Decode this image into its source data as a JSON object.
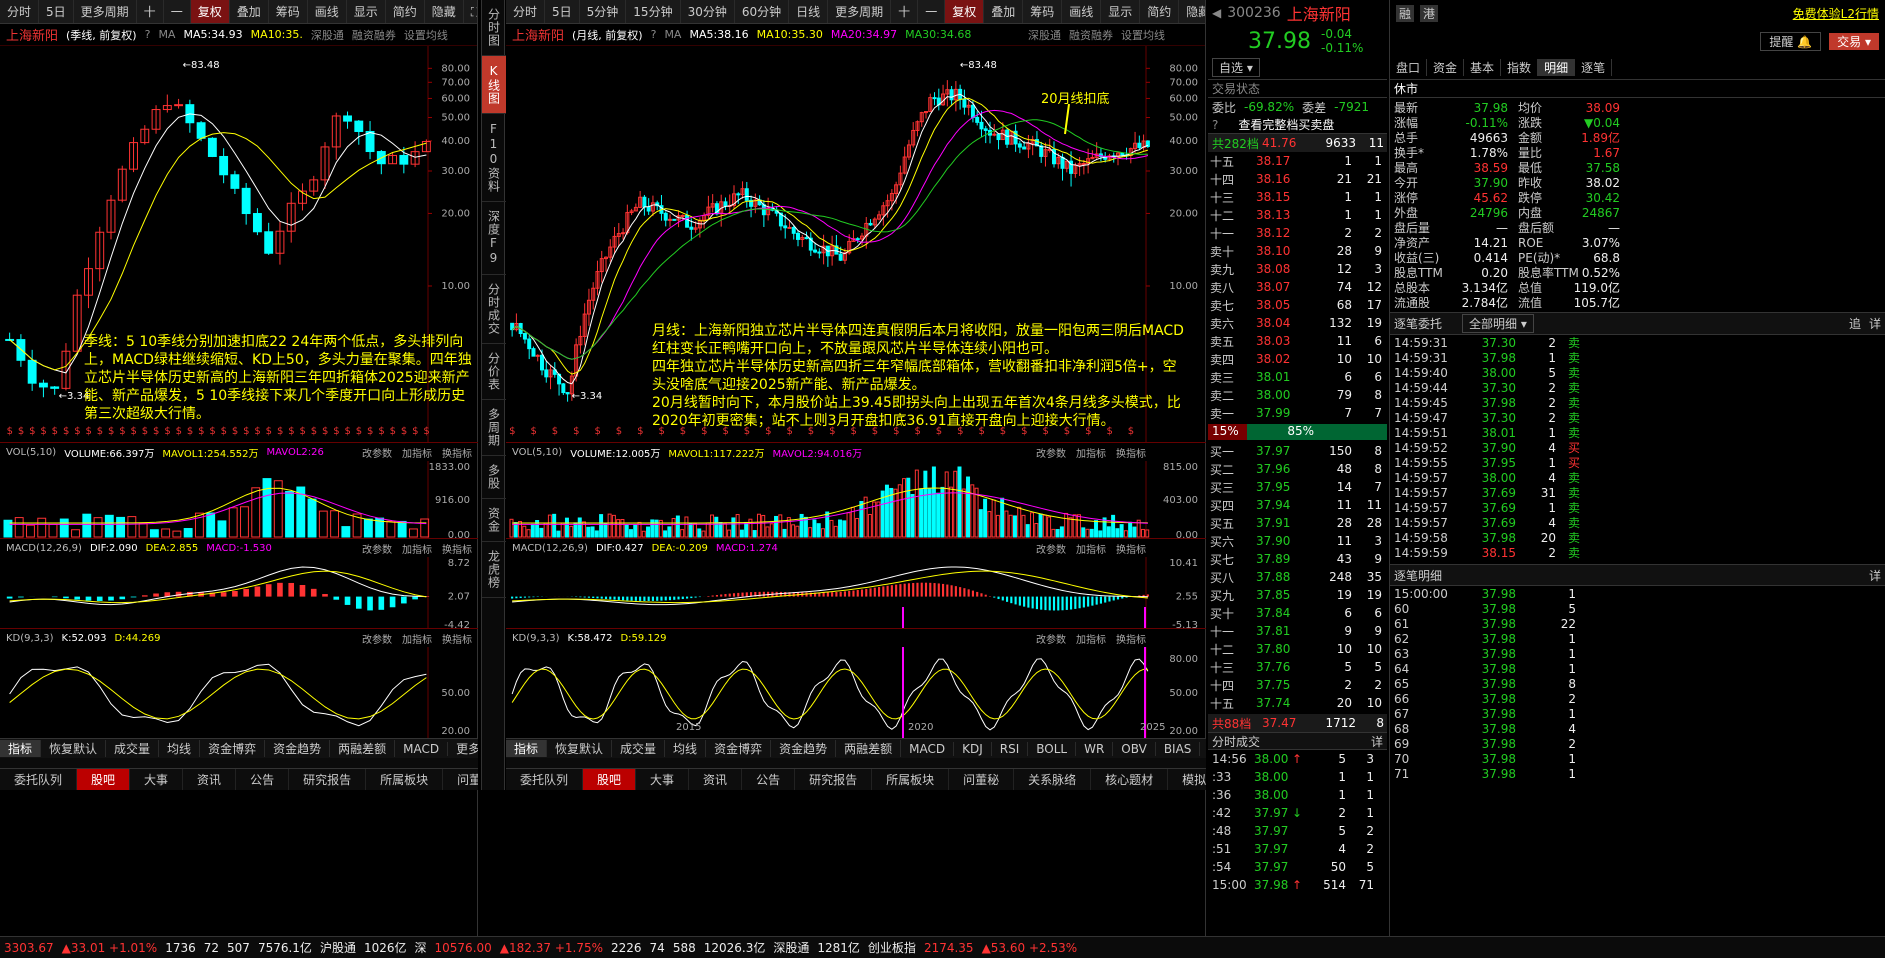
{
  "left": {
    "toolbar": [
      "分时",
      "5日",
      "更多周期",
      "十",
      "一",
      "复权",
      "叠加",
      "筹码",
      "画线",
      "显示",
      "简约",
      "隐藏",
      "⛶"
    ],
    "caption": {
      "name": "上海新阳",
      "period": "(季线, 前复权)",
      "ma_label": "MA",
      "ma5": "MA5:34.93",
      "ma10": "MA10:35.",
      "pill1": "深股通",
      "pill2": "融资融券",
      "setting": "设置均线"
    },
    "price_axis": [
      "80.00",
      "70.00",
      "60.00",
      "50.00",
      "40.00",
      "30.00",
      "20.00",
      "10.00"
    ],
    "hi_label": "83.48",
    "lo_label": "3.34",
    "note": "季线：5 10季线分别加速扣底22 24年两个低点，多头排列向上，MACD绿柱继续缩短、KD上50，多头力量在聚集。四年独立芯片半导体历史新高的上海新阳三年四折箱体2025迎来新产能、新产品爆发，5 10季线接下来几个季度开口向上形成历史第三次超级大行情。",
    "vol": {
      "name": "VOL(5,10)",
      "v": "VOLUME:66.397万",
      "ma1": "MAVOL1:254.552万",
      "ma2": "MAVOL2:26",
      "axis": [
        "1833.00",
        "916.00",
        "0.00"
      ]
    },
    "macd": {
      "name": "MACD(12,26,9)",
      "dif": "DIF:2.090",
      "dea": "DEA:2.855",
      "macd": "MACD:-1.530",
      "axis": [
        "8.72",
        "2.07",
        "-4.42"
      ]
    },
    "kd": {
      "name": "KD(9,3,3)",
      "k": "K:52.093",
      "d": "D:44.269",
      "axis": [
        "50.00",
        "20.00"
      ]
    },
    "ops": [
      "改参数",
      "加指标",
      "换指标"
    ],
    "tabs": [
      "指标",
      "恢复默认",
      "成交量",
      "均线",
      "资金博弈",
      "资金趋势",
      "两融差额",
      "MACD",
      "更多",
      "模板"
    ],
    "bottom_tabs": [
      "委托队列",
      "股吧",
      "大事",
      "资讯",
      "公告",
      "研究报告",
      "所属板块",
      "问董秘",
      "关联"
    ]
  },
  "vtabs": [
    "分时图",
    "K线图",
    "F10资料",
    "深度F9",
    "分时成交",
    "分价表",
    "多周期",
    "多股",
    "资金",
    "龙虎榜"
  ],
  "mid": {
    "toolbar": [
      "分时",
      "5日",
      "5分钟",
      "15分钟",
      "30分钟",
      "60分钟",
      "日线",
      "更多周期",
      "十",
      "一",
      "复权",
      "叠加",
      "筹码",
      "画线",
      "显示",
      "简约",
      "隐藏",
      "⛶"
    ],
    "caption": {
      "name": "上海新阳",
      "period": "(月线, 前复权)",
      "ma_label": "MA",
      "ma5": "MA5:38.16",
      "ma10": "MA10:35.30",
      "ma20": "MA20:34.97",
      "ma30": "MA30:34.68",
      "pill1": "深股通",
      "pill2": "融资融券",
      "setting": "设置均线"
    },
    "price_axis": [
      "80.00",
      "70.00",
      "60.00",
      "50.00",
      "40.00",
      "30.00",
      "20.00",
      "10.00"
    ],
    "hi_label": "83.48",
    "lo_label": "3.34",
    "annot": "20月线扣底",
    "note": "月线：上海新阳独立芯片半导体四连真假阴后本月将收阳，放量一阳包两三阴后MACD红柱变长正鸭嘴开口向上，不放量跟风芯片半导体连续小阳也可。\n四年独立芯片半导体历史新高四折三年窄幅底部箱体，营收翻番扣非净利润5倍+，空头没啥底气迎接2025新产能、新产品爆发。\n20月线暂时向下，本月股价站上39.45即拐头向上出现五年首次4条月线多头模式，比2020年初更密集；站不上则3月开盘扣底36.91直接开盘向上迎接大行情。",
    "vol": {
      "name": "VOL(5,10)",
      "v": "VOLUME:12.005万",
      "ma1": "MAVOL1:117.222万",
      "ma2": "MAVOL2:94.016万",
      "axis": [
        "815.00",
        "403.00",
        "0.00"
      ]
    },
    "macd": {
      "name": "MACD(12,26,9)",
      "dif": "DIF:0.427",
      "dea": "DEA:-0.209",
      "macd": "MACD:1.274",
      "axis": [
        "10.41",
        "2.55",
        "-5.13"
      ]
    },
    "kd": {
      "name": "KD(9,3,3)",
      "k": "K:58.472",
      "d": "D:59.129",
      "axis": [
        "80.00",
        "50.00",
        "20.00"
      ]
    },
    "ops": [
      "改参数",
      "加指标",
      "换指标"
    ],
    "years": [
      "2015",
      "2020",
      "2025"
    ],
    "tabs": [
      "指标",
      "恢复默认",
      "成交量",
      "均线",
      "资金博弈",
      "资金趋势",
      "两融差额",
      "MACD",
      "KDJ",
      "RSI",
      "BOLL",
      "WR",
      "OBV",
      "BIAS",
      "更多",
      "模板"
    ],
    "bottom_tabs": [
      "委托队列",
      "股吧",
      "大事",
      "资讯",
      "公告",
      "研究报告",
      "所属板块",
      "问董秘",
      "关系脉络",
      "核心题材",
      "模拟交易"
    ]
  },
  "quote": {
    "code": "300236",
    "name": "上海新阳",
    "tag1": "融",
    "tag2": "港",
    "promo": "免费体验L2行情",
    "price": "37.98",
    "chg": "-0.04",
    "pct": "-0.11%",
    "btn_self": "自选",
    "btn_alert": "提醒",
    "btn_trade": "交易",
    "status": "交易状态",
    "status_v": "休市",
    "wb_l": "委比",
    "wb_v": "-69.82%",
    "wc_l": "委差",
    "wc_v": "-7921",
    "full_book": "查看完整档买卖盘",
    "sell_total": {
      "label": "共282档",
      "price": "41.76",
      "vol": "9633",
      "n": "11"
    },
    "asks": [
      {
        "l": "十五",
        "p": "38.17",
        "v": "1",
        "n": "1"
      },
      {
        "l": "十四",
        "p": "38.16",
        "v": "21",
        "n": "21"
      },
      {
        "l": "十三",
        "p": "38.15",
        "v": "1",
        "n": "1"
      },
      {
        "l": "十二",
        "p": "38.13",
        "v": "1",
        "n": "1"
      },
      {
        "l": "十一",
        "p": "38.12",
        "v": "2",
        "n": "2"
      },
      {
        "l": "卖十",
        "p": "38.10",
        "v": "28",
        "n": "9"
      },
      {
        "l": "卖九",
        "p": "38.08",
        "v": "12",
        "n": "3"
      },
      {
        "l": "卖八",
        "p": "38.07",
        "v": "74",
        "n": "12"
      },
      {
        "l": "卖七",
        "p": "38.05",
        "v": "68",
        "n": "17"
      },
      {
        "l": "卖六",
        "p": "38.04",
        "v": "132",
        "n": "19"
      },
      {
        "l": "卖五",
        "p": "38.03",
        "v": "11",
        "n": "6"
      },
      {
        "l": "卖四",
        "p": "38.02",
        "v": "10",
        "n": "10"
      },
      {
        "l": "卖三",
        "p": "38.01",
        "v": "6",
        "n": "6"
      },
      {
        "l": "卖二",
        "p": "38.00",
        "v": "79",
        "n": "8"
      },
      {
        "l": "卖一",
        "p": "37.99",
        "v": "7",
        "n": "7"
      }
    ],
    "ratio": {
      "l": "15%",
      "r": "85%"
    },
    "bids": [
      {
        "l": "买一",
        "p": "37.97",
        "v": "150",
        "n": "8"
      },
      {
        "l": "买二",
        "p": "37.96",
        "v": "48",
        "n": "8"
      },
      {
        "l": "买三",
        "p": "37.95",
        "v": "14",
        "n": "7"
      },
      {
        "l": "买四",
        "p": "37.94",
        "v": "11",
        "n": "11"
      },
      {
        "l": "买五",
        "p": "37.91",
        "v": "28",
        "n": "28"
      },
      {
        "l": "买六",
        "p": "37.90",
        "v": "11",
        "n": "3"
      },
      {
        "l": "买七",
        "p": "37.89",
        "v": "43",
        "n": "9"
      },
      {
        "l": "买八",
        "p": "37.88",
        "v": "248",
        "n": "35"
      },
      {
        "l": "买九",
        "p": "37.85",
        "v": "19",
        "n": "19"
      },
      {
        "l": "买十",
        "p": "37.84",
        "v": "6",
        "n": "6"
      },
      {
        "l": "十一",
        "p": "37.81",
        "v": "9",
        "n": "9"
      },
      {
        "l": "十二",
        "p": "37.80",
        "v": "10",
        "n": "10"
      },
      {
        "l": "十三",
        "p": "37.76",
        "v": "5",
        "n": "5"
      },
      {
        "l": "十四",
        "p": "37.75",
        "v": "2",
        "n": "2"
      },
      {
        "l": "十五",
        "p": "37.74",
        "v": "20",
        "n": "10"
      }
    ],
    "buy_total": {
      "label": "共88档",
      "price": "37.47",
      "vol": "1712",
      "n": "8"
    },
    "tick_title": "分时成交",
    "tick_more": "详",
    "ticks": [
      {
        "t": "14:56",
        "p": "38.00",
        "a": "↑",
        "v": "5",
        "n": "3"
      },
      {
        "t": ":33",
        "p": "38.00",
        "a": "",
        "v": "1",
        "n": "1"
      },
      {
        "t": ":36",
        "p": "38.00",
        "a": "",
        "v": "1",
        "n": "1"
      },
      {
        "t": ":42",
        "p": "37.97",
        "a": "↓",
        "v": "2",
        "n": "1"
      },
      {
        "t": ":48",
        "p": "37.97",
        "a": "",
        "v": "5",
        "n": "2"
      },
      {
        "t": ":51",
        "p": "37.97",
        "a": "",
        "v": "4",
        "n": "2"
      },
      {
        "t": ":54",
        "p": "37.97",
        "a": "",
        "v": "50",
        "n": "5"
      },
      {
        "t": "15:00",
        "p": "37.98",
        "a": "↑",
        "v": "514",
        "n": "71"
      }
    ]
  },
  "stats": {
    "tabs": [
      "盘口",
      "资金",
      "基本",
      "指数",
      "明细",
      "逐笔"
    ],
    "rows": [
      [
        "最新",
        "37.98",
        "均价",
        "38.09"
      ],
      [
        "涨幅",
        "-0.11%",
        "涨跌",
        "▼0.04"
      ],
      [
        "总手",
        "49663",
        "金额",
        "1.89亿"
      ],
      [
        "换手*",
        "1.78%",
        "量比",
        "1.67"
      ],
      [
        "最高",
        "38.59",
        "最低",
        "37.58"
      ],
      [
        "今开",
        "37.90",
        "昨收",
        "38.02"
      ],
      [
        "涨停",
        "45.62",
        "跌停",
        "30.42"
      ],
      [
        "外盘",
        "24796",
        "内盘",
        "24867"
      ],
      [
        "盘后量",
        "—",
        "盘后额",
        "—"
      ],
      [
        "净资产",
        "14.21",
        "ROE",
        "3.07%"
      ],
      [
        "收益(三)",
        "0.414",
        "PE(动)*",
        "68.8"
      ],
      [
        "股息TTM",
        "0.20",
        "股息率TTM",
        "0.52%"
      ],
      [
        "总股本",
        "3.134亿",
        "总值",
        "119.0亿"
      ],
      [
        "流通股",
        "2.784亿",
        "流值",
        "105.7亿"
      ]
    ],
    "zbwt_title": "逐笔委托",
    "zbwt_sel": "全部明细",
    "zbwt_btn": "追",
    "zbwt_more": "详",
    "zbwt": [
      [
        "14:59:31",
        "37.30",
        "2",
        "卖"
      ],
      [
        "14:59:31",
        "37.98",
        "1",
        "卖"
      ],
      [
        "14:59:40",
        "38.00",
        "5",
        "卖"
      ],
      [
        "14:59:44",
        "37.30",
        "2",
        "卖"
      ],
      [
        "14:59:45",
        "37.98",
        "2",
        "卖"
      ],
      [
        "14:59:47",
        "37.30",
        "2",
        "卖"
      ],
      [
        "14:59:51",
        "38.01",
        "1",
        "卖"
      ],
      [
        "14:59:52",
        "37.90",
        "4",
        "买"
      ],
      [
        "14:59:55",
        "37.95",
        "1",
        "买"
      ],
      [
        "14:59:57",
        "38.00",
        "4",
        "卖"
      ],
      [
        "14:59:57",
        "37.69",
        "31",
        "卖"
      ],
      [
        "14:59:57",
        "37.69",
        "1",
        "卖"
      ],
      [
        "14:59:57",
        "37.69",
        "4",
        "卖"
      ],
      [
        "14:59:58",
        "37.98",
        "20",
        "卖"
      ],
      [
        "14:59:59",
        "38.15",
        "2",
        "卖"
      ]
    ],
    "zbmx_title": "逐笔明细",
    "zbmx_more": "详",
    "zbmx": [
      [
        "15:00:00",
        "37.98",
        "1"
      ],
      [
        "60",
        "37.98",
        "5"
      ],
      [
        "61",
        "37.98",
        "22"
      ],
      [
        "62",
        "37.98",
        "1"
      ],
      [
        "63",
        "37.98",
        "1"
      ],
      [
        "64",
        "37.98",
        "1"
      ],
      [
        "65",
        "37.98",
        "8"
      ],
      [
        "66",
        "37.98",
        "2"
      ],
      [
        "67",
        "37.98",
        "1"
      ],
      [
        "68",
        "37.98",
        "4"
      ],
      [
        "69",
        "37.98",
        "2"
      ],
      [
        "70",
        "37.98",
        "1"
      ],
      [
        "71",
        "37.98",
        "1"
      ]
    ]
  },
  "statusbar": [
    "3303.67",
    "▲33.01 +1.01%",
    "1736",
    "72",
    "507",
    "7576.1亿",
    "沪股通",
    "1026亿",
    "深",
    "10576.00",
    "▲182.37 +1.75%",
    "2226",
    "74",
    "588",
    "12026.3亿",
    "深股通",
    "1281亿",
    "创业板指",
    "2174.35",
    "▲53.60 +2.53%"
  ],
  "chart_data": [
    {
      "type": "candlestick",
      "title": "上海新阳 (季线, 前复权)",
      "y_scale": "log",
      "y_range": [
        3.34,
        83.48
      ],
      "high": 83.48,
      "low": 3.34,
      "ma": {
        "MA5": 34.93
      }
    },
    {
      "type": "candlestick",
      "title": "上海新阳 (月线, 前复权)",
      "y_scale": "log",
      "y_range": [
        3.34,
        83.48
      ],
      "high": 83.48,
      "low": 3.34,
      "ma": {
        "MA5": 38.16,
        "MA10": 35.3,
        "MA20": 34.97,
        "MA30": 34.68
      },
      "x_ticks": [
        "2015",
        "2020",
        "2025"
      ]
    }
  ]
}
